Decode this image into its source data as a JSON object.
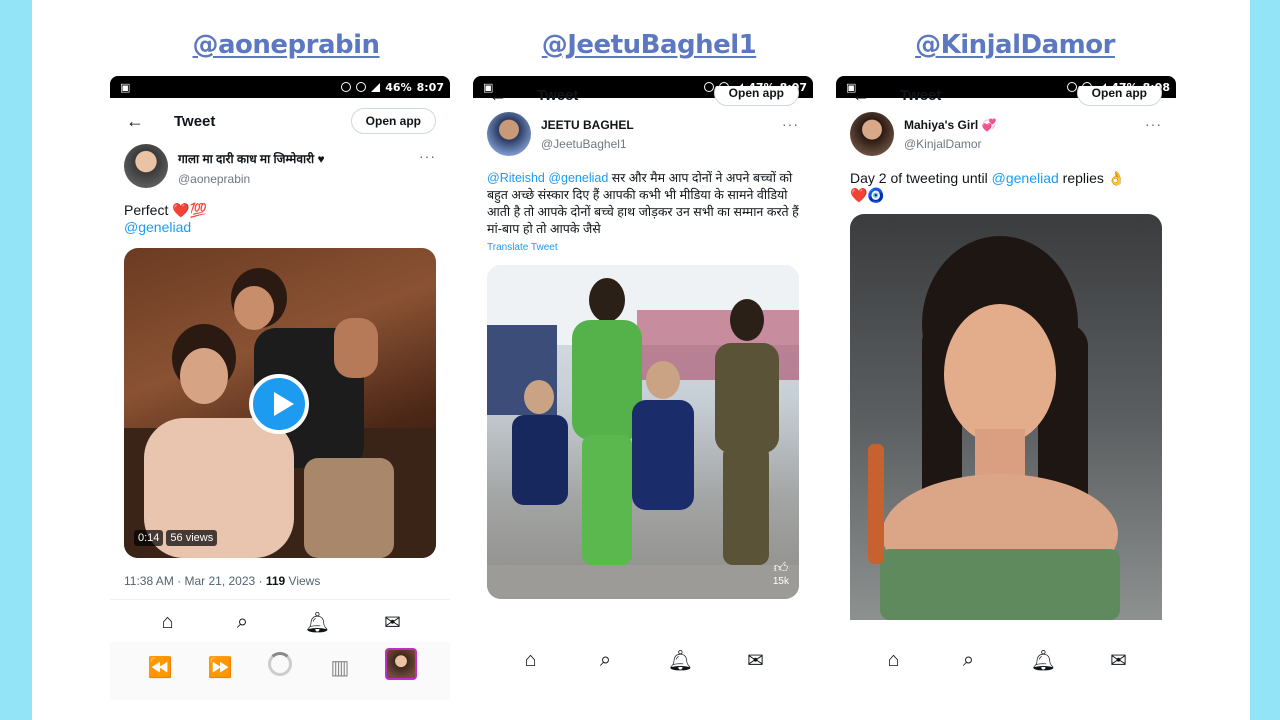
{
  "columns": [
    {
      "handle_title": "@aoneprabin",
      "status_time": "8:07",
      "battery": "46%",
      "header": {
        "back_icon": "arrow-left-icon",
        "title": "Tweet",
        "open_app": "Open app"
      },
      "author": {
        "name": "गाला मा दारी काध मा जिम्मेवारी",
        "handle": "@aoneprabin"
      },
      "text": "Perfect ❤️💯",
      "mention": "@geneliad",
      "video": {
        "duration": "0:14",
        "views": "56 views"
      },
      "meta": {
        "time": "11:38 AM · Mar 21, 2023 · ",
        "views_count": "119",
        "views_label": " Views"
      },
      "nav_icons": [
        "home-icon",
        "search-icon",
        "bell-icon",
        "mail-icon"
      ]
    },
    {
      "handle_title": "@JeetuBaghel1",
      "status_time": "8:07",
      "battery": "47%",
      "header": {
        "back_icon": "arrow-left-icon",
        "title": "Tweet",
        "open_app": "Open app"
      },
      "author": {
        "name": "JEETU BAGHEL",
        "handle": "@JeetuBaghel1"
      },
      "mentions": "@Riteishd @geneliad",
      "text": " सर और मैम आप दोनों ने अपने बच्चों को बहुत अच्छे संस्कार दिए हैं आपकी कभी भी मीडिया के सामने वीडियो आती है तो आपके दोनों बच्चे हाथ जोड़कर उन सभी का सम्मान करते हैं मां-बाप हो तो आपके जैसे",
      "translate": "Translate Tweet",
      "like_count": "15k",
      "nav_icons": [
        "home-icon",
        "search-icon",
        "bell-icon",
        "mail-icon"
      ]
    },
    {
      "handle_title": "@KinjalDamor",
      "status_time": "8:08",
      "battery": "47%",
      "header": {
        "back_icon": "arrow-left-icon",
        "title": "Tweet",
        "open_app": "Open app"
      },
      "author": {
        "name": "Mahiya's Girl 💞",
        "handle": "@KinjalDamor"
      },
      "text_before": "Day 2 of tweeting until ",
      "mention": "@geneliad",
      "text_after": " replies 👌",
      "emoji_line": "❤️🧿",
      "nav_icons": [
        "home-icon",
        "search-icon",
        "bell-icon",
        "mail-icon"
      ]
    }
  ]
}
